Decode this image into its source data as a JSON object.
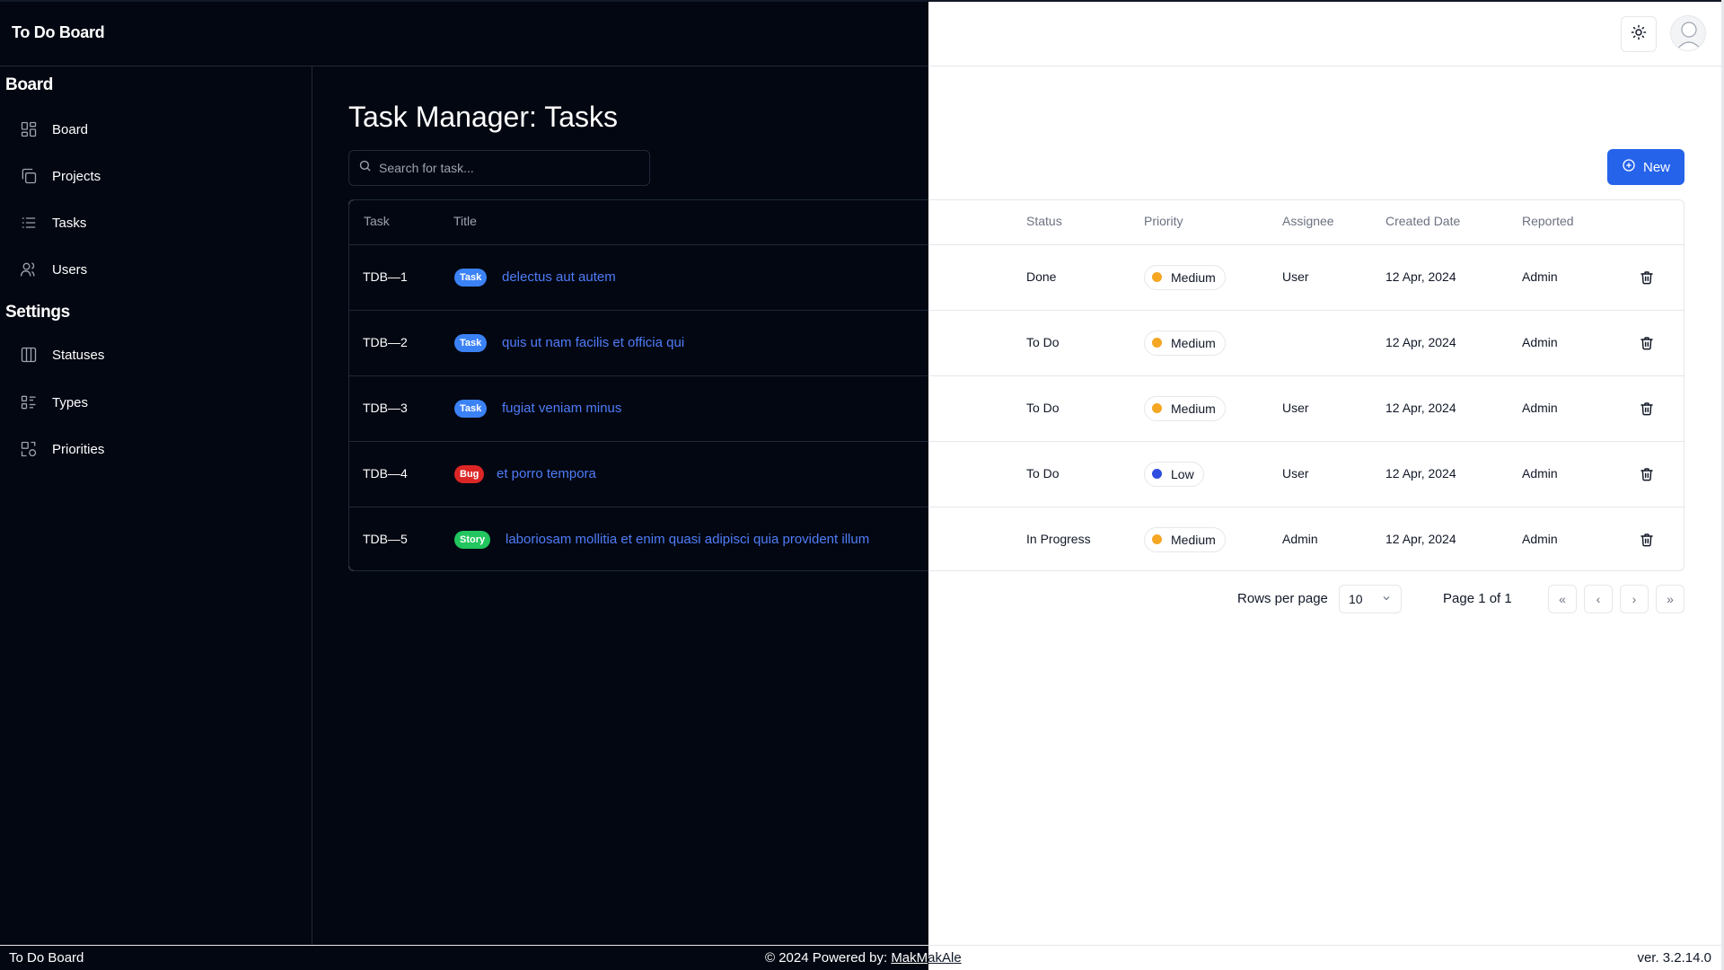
{
  "app": {
    "title": "To Do Board"
  },
  "header": {
    "theme_icon": "sun-icon",
    "avatar_icon": "user-avatar-icon"
  },
  "sidebar": {
    "sections": [
      {
        "title": "Board",
        "items": [
          {
            "label": "Board",
            "icon": "board-grid-icon"
          },
          {
            "label": "Projects",
            "icon": "projects-copy-icon"
          },
          {
            "label": "Tasks",
            "icon": "list-icon"
          },
          {
            "label": "Users",
            "icon": "users-icon"
          }
        ]
      },
      {
        "title": "Settings",
        "items": [
          {
            "label": "Statuses",
            "icon": "columns-icon"
          },
          {
            "label": "Types",
            "icon": "list-details-icon"
          },
          {
            "label": "Priorities",
            "icon": "shapes-icon"
          }
        ]
      }
    ]
  },
  "main": {
    "title": "Task Manager: Tasks",
    "search_placeholder": "Search for task...",
    "new_button": "New"
  },
  "table": {
    "columns": [
      "Task",
      "Title",
      "Status",
      "Priority",
      "Assignee",
      "Created Date",
      "Reported"
    ],
    "rows": [
      {
        "task": "TDB—1",
        "type": "Task",
        "title": "delectus aut autem",
        "status": "Done",
        "priority": "Medium",
        "assignee": "User",
        "created": "12 Apr, 2024",
        "reported": "Admin"
      },
      {
        "task": "TDB—2",
        "type": "Task",
        "title": "quis ut nam facilis et officia qui",
        "status": "To Do",
        "priority": "Medium",
        "assignee": "",
        "created": "12 Apr, 2024",
        "reported": "Admin"
      },
      {
        "task": "TDB—3",
        "type": "Task",
        "title": "fugiat veniam minus",
        "status": "To Do",
        "priority": "Medium",
        "assignee": "User",
        "created": "12 Apr, 2024",
        "reported": "Admin"
      },
      {
        "task": "TDB—4",
        "type": "Bug",
        "title": "et porro tempora",
        "status": "To Do",
        "priority": "Low",
        "assignee": "User",
        "created": "12 Apr, 2024",
        "reported": "Admin"
      },
      {
        "task": "TDB—5",
        "type": "Story",
        "title": "laboriosam mollitia et enim quasi adipisci quia provident illum",
        "status": "In Progress",
        "priority": "Medium",
        "assignee": "Admin",
        "created": "12 Apr, 2024",
        "reported": "Admin"
      }
    ]
  },
  "type_colors": {
    "Task": "#3b82f6",
    "Bug": "#dc2626",
    "Story": "#22c55e"
  },
  "priority_colors": {
    "Medium": "#f5a623",
    "Low": "#2f4de0"
  },
  "pagination": {
    "rows_label": "Rows per page",
    "rows_value": "10",
    "page_info": "Page 1 of 1",
    "first": "«",
    "prev": "‹",
    "next": "›",
    "last": "»"
  },
  "footer": {
    "left": "To Do Board",
    "center_prefix": "© 2024 Powered by: ",
    "center_link_a": "MakM",
    "center_link_b": "akAle",
    "version": "ver. 3.2.14.0"
  }
}
